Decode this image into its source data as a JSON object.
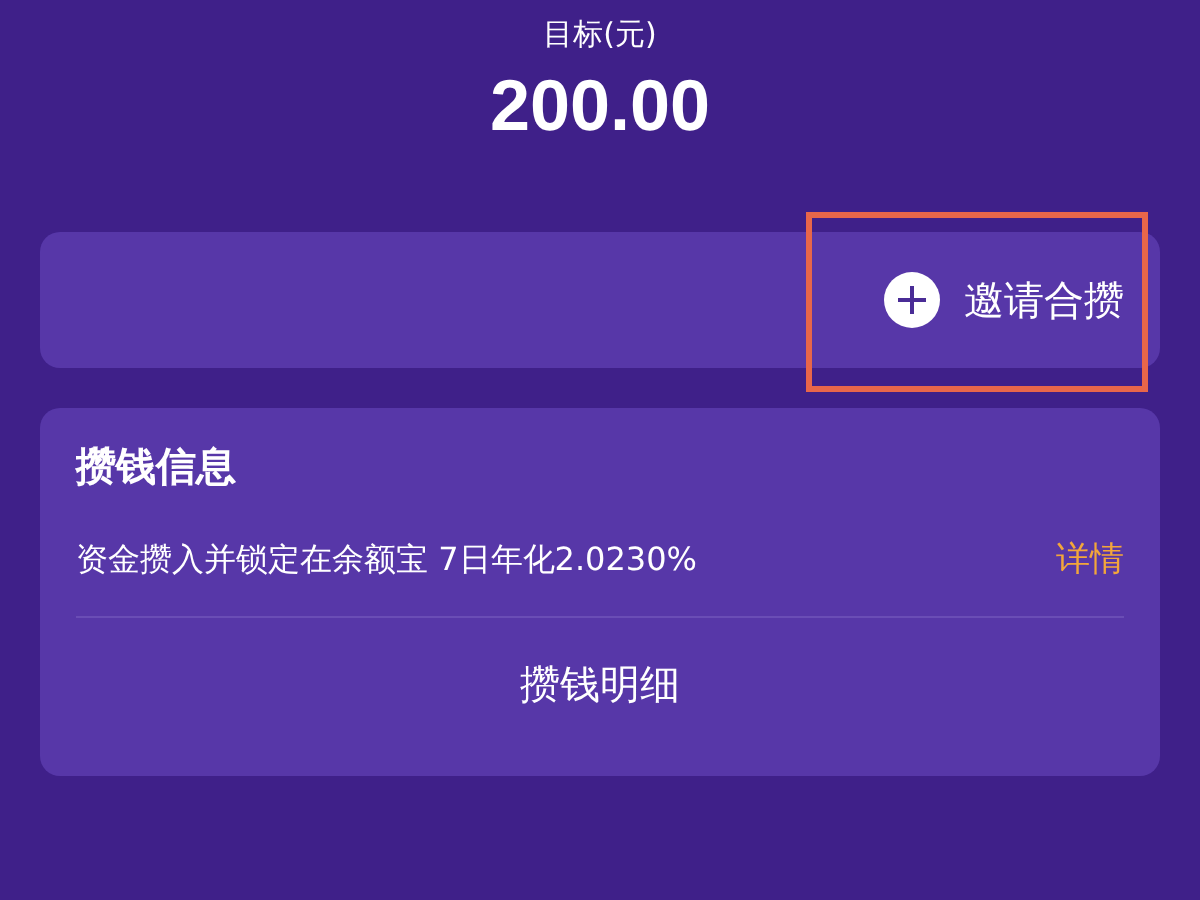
{
  "goal": {
    "label": "目标(元)",
    "amount": "200.00"
  },
  "invite": {
    "label": "邀请合攒",
    "highlighted": true
  },
  "info": {
    "title": "攒钱信息",
    "description": "资金攒入并锁定在余额宝 7日年化2.0230%",
    "link": "详情",
    "footer": "攒钱明细"
  }
}
